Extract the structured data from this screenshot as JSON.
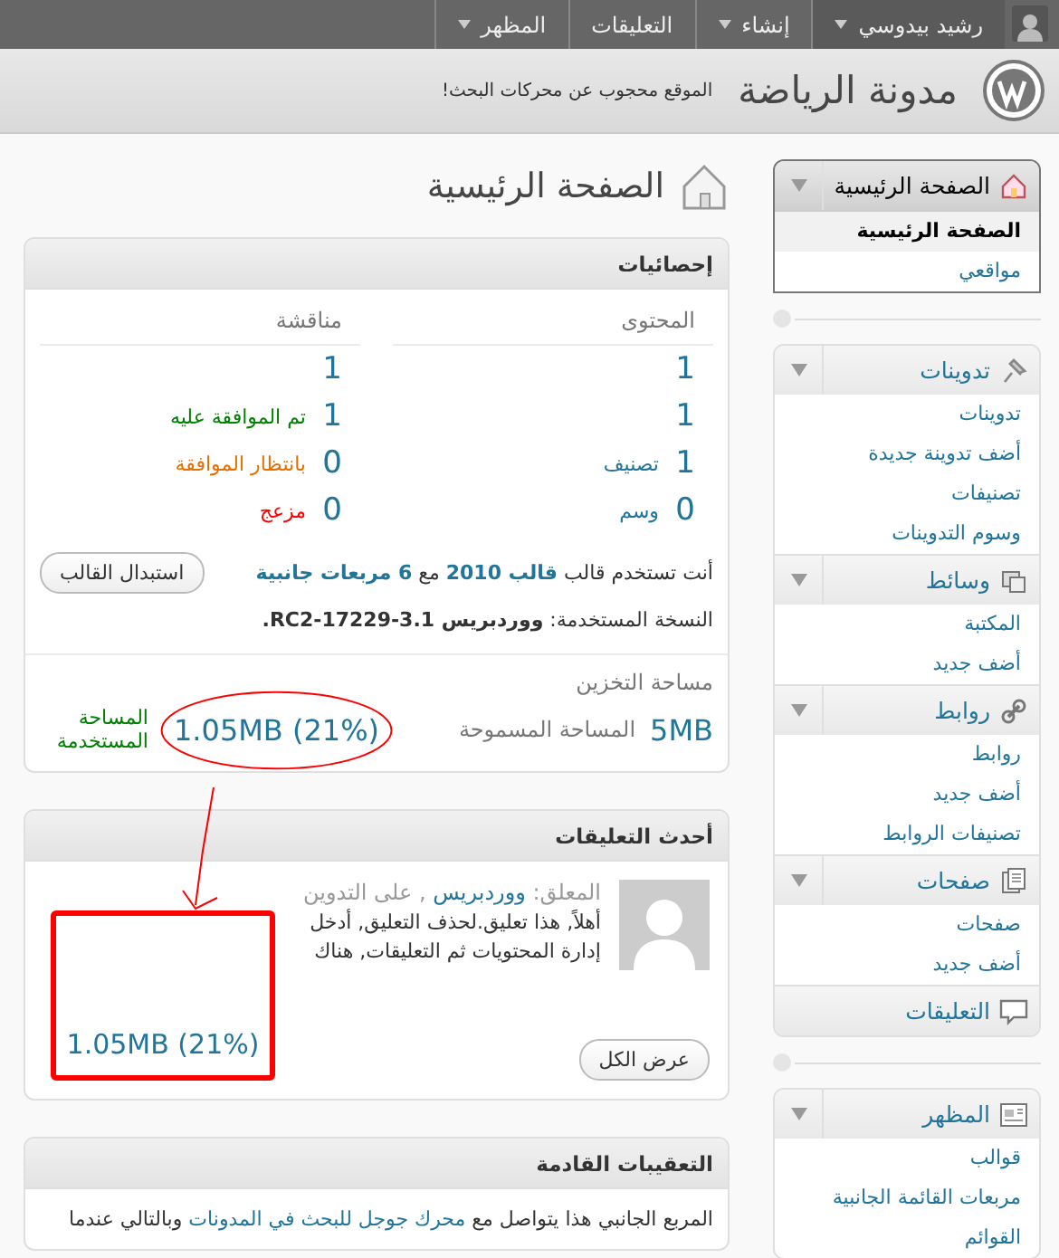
{
  "admin_bar": {
    "user": {
      "label": "رشيد بيدوسي",
      "has_menu": true
    },
    "menus": [
      {
        "label": "إنشاء",
        "has_menu": true
      },
      {
        "label": "التعليقات",
        "has_menu": false
      },
      {
        "label": "المظهر",
        "has_menu": true
      }
    ]
  },
  "header": {
    "site_title": "مدونة الرياضة",
    "notice": "الموقع محجوب عن محركات البحث!"
  },
  "page_title": "الصفحة الرئيسية",
  "sidebar": {
    "sections": [
      {
        "groups": [
          {
            "label": "الصفحة الرئيسية",
            "kind": "house",
            "selected": true,
            "expanded": true,
            "items": [
              {
                "label": "الصفحة الرئيسية",
                "selected": true
              },
              {
                "label": "مواقعي",
                "selected": false
              }
            ]
          }
        ]
      },
      {
        "groups": [
          {
            "label": "تدوينات",
            "kind": "pin",
            "selected": false,
            "expanded": true,
            "items": [
              {
                "label": "تدوينات",
                "selected": false
              },
              {
                "label": "أضف تدوينة جديدة",
                "selected": false
              },
              {
                "label": "تصنيفات",
                "selected": false
              },
              {
                "label": "وسوم التدوينات",
                "selected": false
              }
            ]
          },
          {
            "label": "وسائط",
            "kind": "media",
            "selected": false,
            "expanded": true,
            "items": [
              {
                "label": "المكتبة",
                "selected": false
              },
              {
                "label": "أضف جديد",
                "selected": false
              }
            ]
          },
          {
            "label": "روابط",
            "kind": "link",
            "selected": false,
            "expanded": true,
            "items": [
              {
                "label": "روابط",
                "selected": false
              },
              {
                "label": "أضف جديد",
                "selected": false
              },
              {
                "label": "تصنيفات الروابط",
                "selected": false
              }
            ]
          },
          {
            "label": "صفحات",
            "kind": "pages",
            "selected": false,
            "expanded": true,
            "items": [
              {
                "label": "صفحات",
                "selected": false
              },
              {
                "label": "أضف جديد",
                "selected": false
              }
            ]
          },
          {
            "label": "التعليقات",
            "kind": "comment",
            "selected": false
          }
        ]
      },
      {
        "groups": [
          {
            "label": "المظهر",
            "kind": "appearance",
            "selected": false,
            "expanded": true,
            "items": [
              {
                "label": "قوالب",
                "selected": false
              },
              {
                "label": "مربعات القائمة الجانبية",
                "selected": false
              },
              {
                "label": "القوائم",
                "selected": false
              }
            ]
          }
        ]
      }
    ]
  },
  "dashboard": {
    "stats": {
      "title": "إحصائيات",
      "content_heading": "المحتوى",
      "discussion_heading": "مناقشة",
      "content": [
        {
          "count": "1"
        },
        {
          "count": "1"
        },
        {
          "count": "1",
          "label": "تصنيف"
        },
        {
          "count": "0",
          "label": "وسم"
        }
      ],
      "discussion": [
        {
          "count": "1"
        },
        {
          "count": "1",
          "label": "تم الموافقة عليه",
          "color": "#008000"
        },
        {
          "count": "0",
          "label": "بانتظار الموافقة",
          "color": "#e66f00"
        },
        {
          "count": "0",
          "label": "مزعج",
          "color": "#ff0000"
        }
      ],
      "theme_line": [
        {
          "kind": "text",
          "text": "أنت تستخدم قالب"
        },
        {
          "kind": "link",
          "text": "قالب 2010"
        },
        {
          "kind": "text",
          "text": "مع"
        },
        {
          "kind": "link",
          "text": "6 مربعات جانبية"
        }
      ],
      "change_theme_button": "استبدال القالب",
      "version_line": "النسخة المستخدمة: **ووردبريس 3.1-RC2-17229.**",
      "storage": {
        "heading": "مساحة التخزين",
        "allowed": "5MB",
        "allowed_label": "المساحة المسموحة",
        "used": "1.05MB (21%)",
        "used_label": "المساحة المستخدمة"
      }
    },
    "recent_comments": {
      "title": "أحدث التعليقات",
      "author_line": [
        {
          "kind": "text",
          "text": "المعلق:"
        },
        {
          "kind": "link",
          "text": "ووردبريس"
        },
        {
          "kind": "text",
          "text": ", على التدوين"
        }
      ],
      "excerpt": [
        "أهلاً, هذا تعليق.لحذف التعليق, أدخل",
        "إدارة المحتويات ثم التعليقات, هناك"
      ],
      "view_all_button": "عرض الكل"
    },
    "incoming_links": {
      "title": "التعقيبات القادمة",
      "text": [
        {
          "kind": "text",
          "text": "المربع الجانبي هذا يتواصل مع"
        },
        {
          "kind": "link",
          "text": "محرك جوجل للبحث في المدونات"
        },
        {
          "kind": "text",
          "text": "وبالتالي عندما"
        }
      ]
    }
  },
  "annotation": {
    "zoomed_text": "1.05MB (21%)"
  }
}
